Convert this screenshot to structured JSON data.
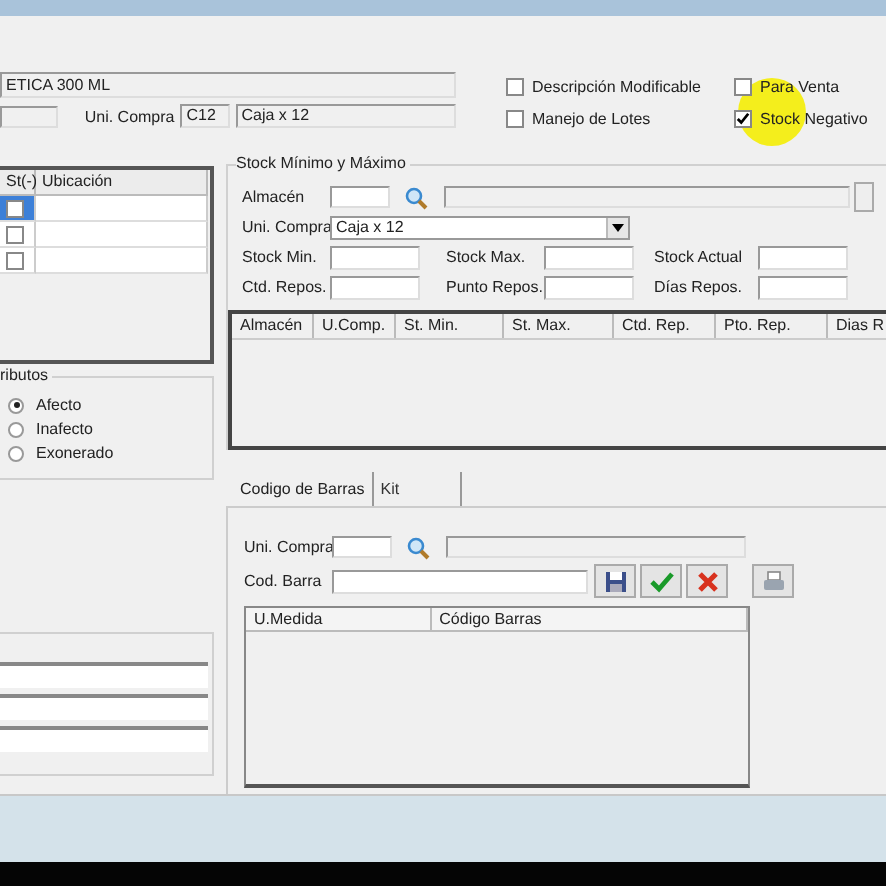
{
  "product": {
    "description": "ETICA 300 ML",
    "uni_compra_label": "Uni. Compra",
    "uni_compra_code": "C12",
    "uni_compra_name": "Caja x 12"
  },
  "options": [
    {
      "label": "Descripción Modificable",
      "checked": false
    },
    {
      "label": "Para Venta",
      "checked": false
    },
    {
      "label": "Manejo de Lotes",
      "checked": false
    },
    {
      "label": "Stock Negativo",
      "checked": true
    }
  ],
  "locations": {
    "columns": [
      "St(-)",
      "Ubicación"
    ],
    "rows": [
      {
        "checked": false,
        "selected": true
      },
      {
        "checked": false,
        "selected": false
      },
      {
        "checked": false,
        "selected": false
      }
    ]
  },
  "tributos": {
    "title": "ributos",
    "options": [
      {
        "label": "Afecto",
        "selected": true
      },
      {
        "label": "Inafecto",
        "selected": false
      },
      {
        "label": "Exonerado",
        "selected": false
      }
    ]
  },
  "stock": {
    "title": "Stock Mínimo y Máximo",
    "almacen_label": "Almacén",
    "uni_compra_label": "Uni. Compra",
    "uni_compra_value": "Caja x 12",
    "fields": [
      {
        "label": "Stock Min."
      },
      {
        "label": "Stock Max."
      },
      {
        "label": "Stock Actual"
      },
      {
        "label": "Ctd. Repos."
      },
      {
        "label": "Punto Repos."
      },
      {
        "label": "Días Repos."
      }
    ],
    "columns": [
      "Almacén",
      "U.Comp.",
      "St. Min.",
      "St. Max.",
      "Ctd. Rep.",
      "Pto. Rep.",
      "Dias R"
    ]
  },
  "tabs": [
    {
      "label": "Codigo de Barras",
      "selected": true
    },
    {
      "label": "Kit",
      "selected": false
    }
  ],
  "barcode": {
    "uni_compra_label": "Uni. Compra",
    "cod_barra_label": "Cod. Barra",
    "columns": [
      "U.Medida",
      "Código Barras"
    ]
  }
}
